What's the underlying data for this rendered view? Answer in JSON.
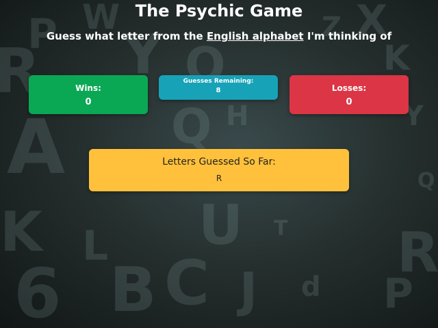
{
  "header": {
    "title": "The Psychic Game",
    "subtitle_prefix": "Guess what letter from the ",
    "subtitle_link": "English alphabet",
    "subtitle_suffix": " I'm thinking of"
  },
  "stats": {
    "wins_label": "Wins:",
    "wins_value": "0",
    "remaining_label": "Guesses Remaining:",
    "remaining_value": "8",
    "losses_label": "Losses:",
    "losses_value": "0"
  },
  "guessed": {
    "label": "Letters Guessed So Far:",
    "value": "R"
  },
  "colors": {
    "wins": "#0aa854",
    "remaining": "#17a2b8",
    "losses": "#dc3545",
    "guessed": "#ffc13b"
  }
}
